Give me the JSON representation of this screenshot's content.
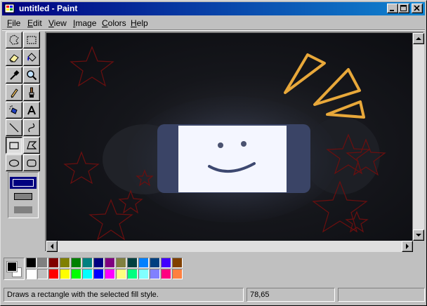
{
  "window": {
    "title": "untitled - Paint",
    "app_icon": "paint-icon",
    "controls": [
      "minimize-icon",
      "maximize-icon",
      "close-icon"
    ]
  },
  "menu": [
    {
      "label": "File"
    },
    {
      "label": "Edit"
    },
    {
      "label": "View"
    },
    {
      "label": "Image"
    },
    {
      "label": "Colors"
    },
    {
      "label": "Help"
    }
  ],
  "tools": [
    {
      "name": "free-form-select",
      "icon": "free-form-select-icon"
    },
    {
      "name": "select",
      "icon": "select-icon"
    },
    {
      "name": "eraser",
      "icon": "eraser-icon"
    },
    {
      "name": "fill-with-color",
      "icon": "paint-bucket-icon"
    },
    {
      "name": "pick-color",
      "icon": "eyedropper-icon"
    },
    {
      "name": "magnifier",
      "icon": "magnifier-icon"
    },
    {
      "name": "pencil",
      "icon": "pencil-icon"
    },
    {
      "name": "brush",
      "icon": "brush-icon"
    },
    {
      "name": "airbrush",
      "icon": "airbrush-icon"
    },
    {
      "name": "text",
      "icon": "text-icon"
    },
    {
      "name": "line",
      "icon": "line-icon"
    },
    {
      "name": "curve",
      "icon": "curve-icon"
    },
    {
      "name": "rectangle",
      "icon": "rectangle-icon",
      "selected": true
    },
    {
      "name": "polygon",
      "icon": "polygon-icon"
    },
    {
      "name": "ellipse",
      "icon": "ellipse-icon"
    },
    {
      "name": "rounded-rectangle",
      "icon": "rounded-rectangle-icon"
    }
  ],
  "fill_style_options": [
    "outline",
    "outline-and-fill",
    "fill"
  ],
  "selected_fill_style": "outline",
  "current_colors": {
    "foreground": "#000000",
    "background": "#ffffff"
  },
  "palette": [
    "#000000",
    "#808080",
    "#800000",
    "#808000",
    "#008000",
    "#008080",
    "#000080",
    "#800080",
    "#808040",
    "#004040",
    "#0080ff",
    "#004080",
    "#4000ff",
    "#804000",
    "#ffffff",
    "#c0c0c0",
    "#ff0000",
    "#ffff00",
    "#00ff00",
    "#00ffff",
    "#0000ff",
    "#ff00ff",
    "#ffff80",
    "#00ff80",
    "#80ffff",
    "#8080ff",
    "#ff0080",
    "#ff8040"
  ],
  "canvas": {
    "scene": "photo of a phone screen showing a smiley face with doodled stars and rays",
    "accent_rays": "#e8a83a",
    "star_color": "#6b0f0f",
    "screen_color": "#f4f6ff"
  },
  "status": {
    "help_text": "Draws a rectangle with the selected fill style.",
    "coordinates": "78,65"
  }
}
